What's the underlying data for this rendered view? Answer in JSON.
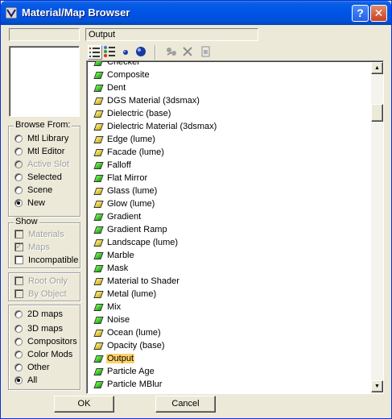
{
  "window": {
    "title": "Material/Map Browser"
  },
  "name_field": {
    "value": ""
  },
  "path_field": {
    "value": "Output"
  },
  "browse_from": {
    "label": "Browse From:",
    "options": [
      {
        "label": "Mtl Library",
        "selected": false,
        "enabled": true
      },
      {
        "label": "Mtl Editor",
        "selected": false,
        "enabled": true
      },
      {
        "label": "Active Slot",
        "selected": false,
        "enabled": false
      },
      {
        "label": "Selected",
        "selected": false,
        "enabled": true
      },
      {
        "label": "Scene",
        "selected": false,
        "enabled": true
      },
      {
        "label": "New",
        "selected": true,
        "enabled": true
      }
    ]
  },
  "show": {
    "label": "Show",
    "options": [
      {
        "label": "Materials",
        "checked": false,
        "enabled": false
      },
      {
        "label": "Maps",
        "checked": true,
        "enabled": false
      },
      {
        "label": "Incompatible",
        "checked": false,
        "enabled": true
      }
    ]
  },
  "filter": {
    "options": [
      {
        "label": "Root Only",
        "checked": false,
        "enabled": false
      },
      {
        "label": "By Object",
        "checked": false,
        "enabled": false
      }
    ]
  },
  "map_types": {
    "options": [
      {
        "label": "2D maps",
        "selected": false
      },
      {
        "label": "3D maps",
        "selected": false
      },
      {
        "label": "Compositors",
        "selected": false
      },
      {
        "label": "Color Mods",
        "selected": false
      },
      {
        "label": "Other",
        "selected": false
      },
      {
        "label": "All",
        "selected": true
      }
    ]
  },
  "toolbar": {
    "icons": [
      "list-view-icon",
      "list-icons-view-icon",
      "small-sphere-icon",
      "large-sphere-icon",
      "update-scene-icon",
      "delete-icon",
      "clear-library-icon"
    ]
  },
  "list": {
    "items": [
      {
        "label": "Checker",
        "color": "green"
      },
      {
        "label": "Composite",
        "color": "green"
      },
      {
        "label": "Dent",
        "color": "green"
      },
      {
        "label": "DGS Material (3dsmax)",
        "color": "yellow"
      },
      {
        "label": "Dielectric (base)",
        "color": "yellow"
      },
      {
        "label": "Dielectric Material (3dsmax)",
        "color": "yellow"
      },
      {
        "label": "Edge (lume)",
        "color": "yellow"
      },
      {
        "label": "Facade (lume)",
        "color": "yellow"
      },
      {
        "label": "Falloff",
        "color": "green"
      },
      {
        "label": "Flat Mirror",
        "color": "green"
      },
      {
        "label": "Glass (lume)",
        "color": "yellow"
      },
      {
        "label": "Glow (lume)",
        "color": "yellow"
      },
      {
        "label": "Gradient",
        "color": "green"
      },
      {
        "label": "Gradient Ramp",
        "color": "green"
      },
      {
        "label": "Landscape (lume)",
        "color": "yellow"
      },
      {
        "label": "Marble",
        "color": "green"
      },
      {
        "label": "Mask",
        "color": "green"
      },
      {
        "label": "Material to Shader",
        "color": "yellow"
      },
      {
        "label": "Metal (lume)",
        "color": "yellow"
      },
      {
        "label": "Mix",
        "color": "green"
      },
      {
        "label": "Noise",
        "color": "green"
      },
      {
        "label": "Ocean (lume)",
        "color": "yellow"
      },
      {
        "label": "Opacity (base)",
        "color": "yellow"
      },
      {
        "label": "Output",
        "color": "green",
        "selected": true
      },
      {
        "label": "Particle Age",
        "color": "green"
      },
      {
        "label": "Particle MBlur",
        "color": "green"
      }
    ]
  },
  "buttons": {
    "ok": "OK",
    "cancel": "Cancel"
  },
  "colors": {
    "title_bar": "#0055ea",
    "selection": "#ffd36a",
    "green_icon": "#33cc22",
    "yellow_icon": "#e8d040"
  }
}
